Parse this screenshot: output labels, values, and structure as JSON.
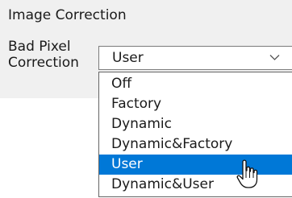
{
  "section": {
    "title": "Image Correction"
  },
  "field": {
    "label": "Bad Pixel\nCorrection"
  },
  "select": {
    "value": "User",
    "chevron_icon": "chevron-down-icon"
  },
  "dropdown": {
    "options": [
      {
        "label": "Off",
        "selected": false
      },
      {
        "label": "Factory",
        "selected": false
      },
      {
        "label": "Dynamic",
        "selected": false
      },
      {
        "label": "Dynamic&Factory",
        "selected": false
      },
      {
        "label": "User",
        "selected": true
      },
      {
        "label": "Dynamic&User",
        "selected": false
      }
    ]
  },
  "colors": {
    "panel_background": "#f0f0f0",
    "highlight": "#0078d7",
    "highlight_text": "#ffffff"
  },
  "pointer": {
    "icon": "pointer-cursor-icon"
  }
}
